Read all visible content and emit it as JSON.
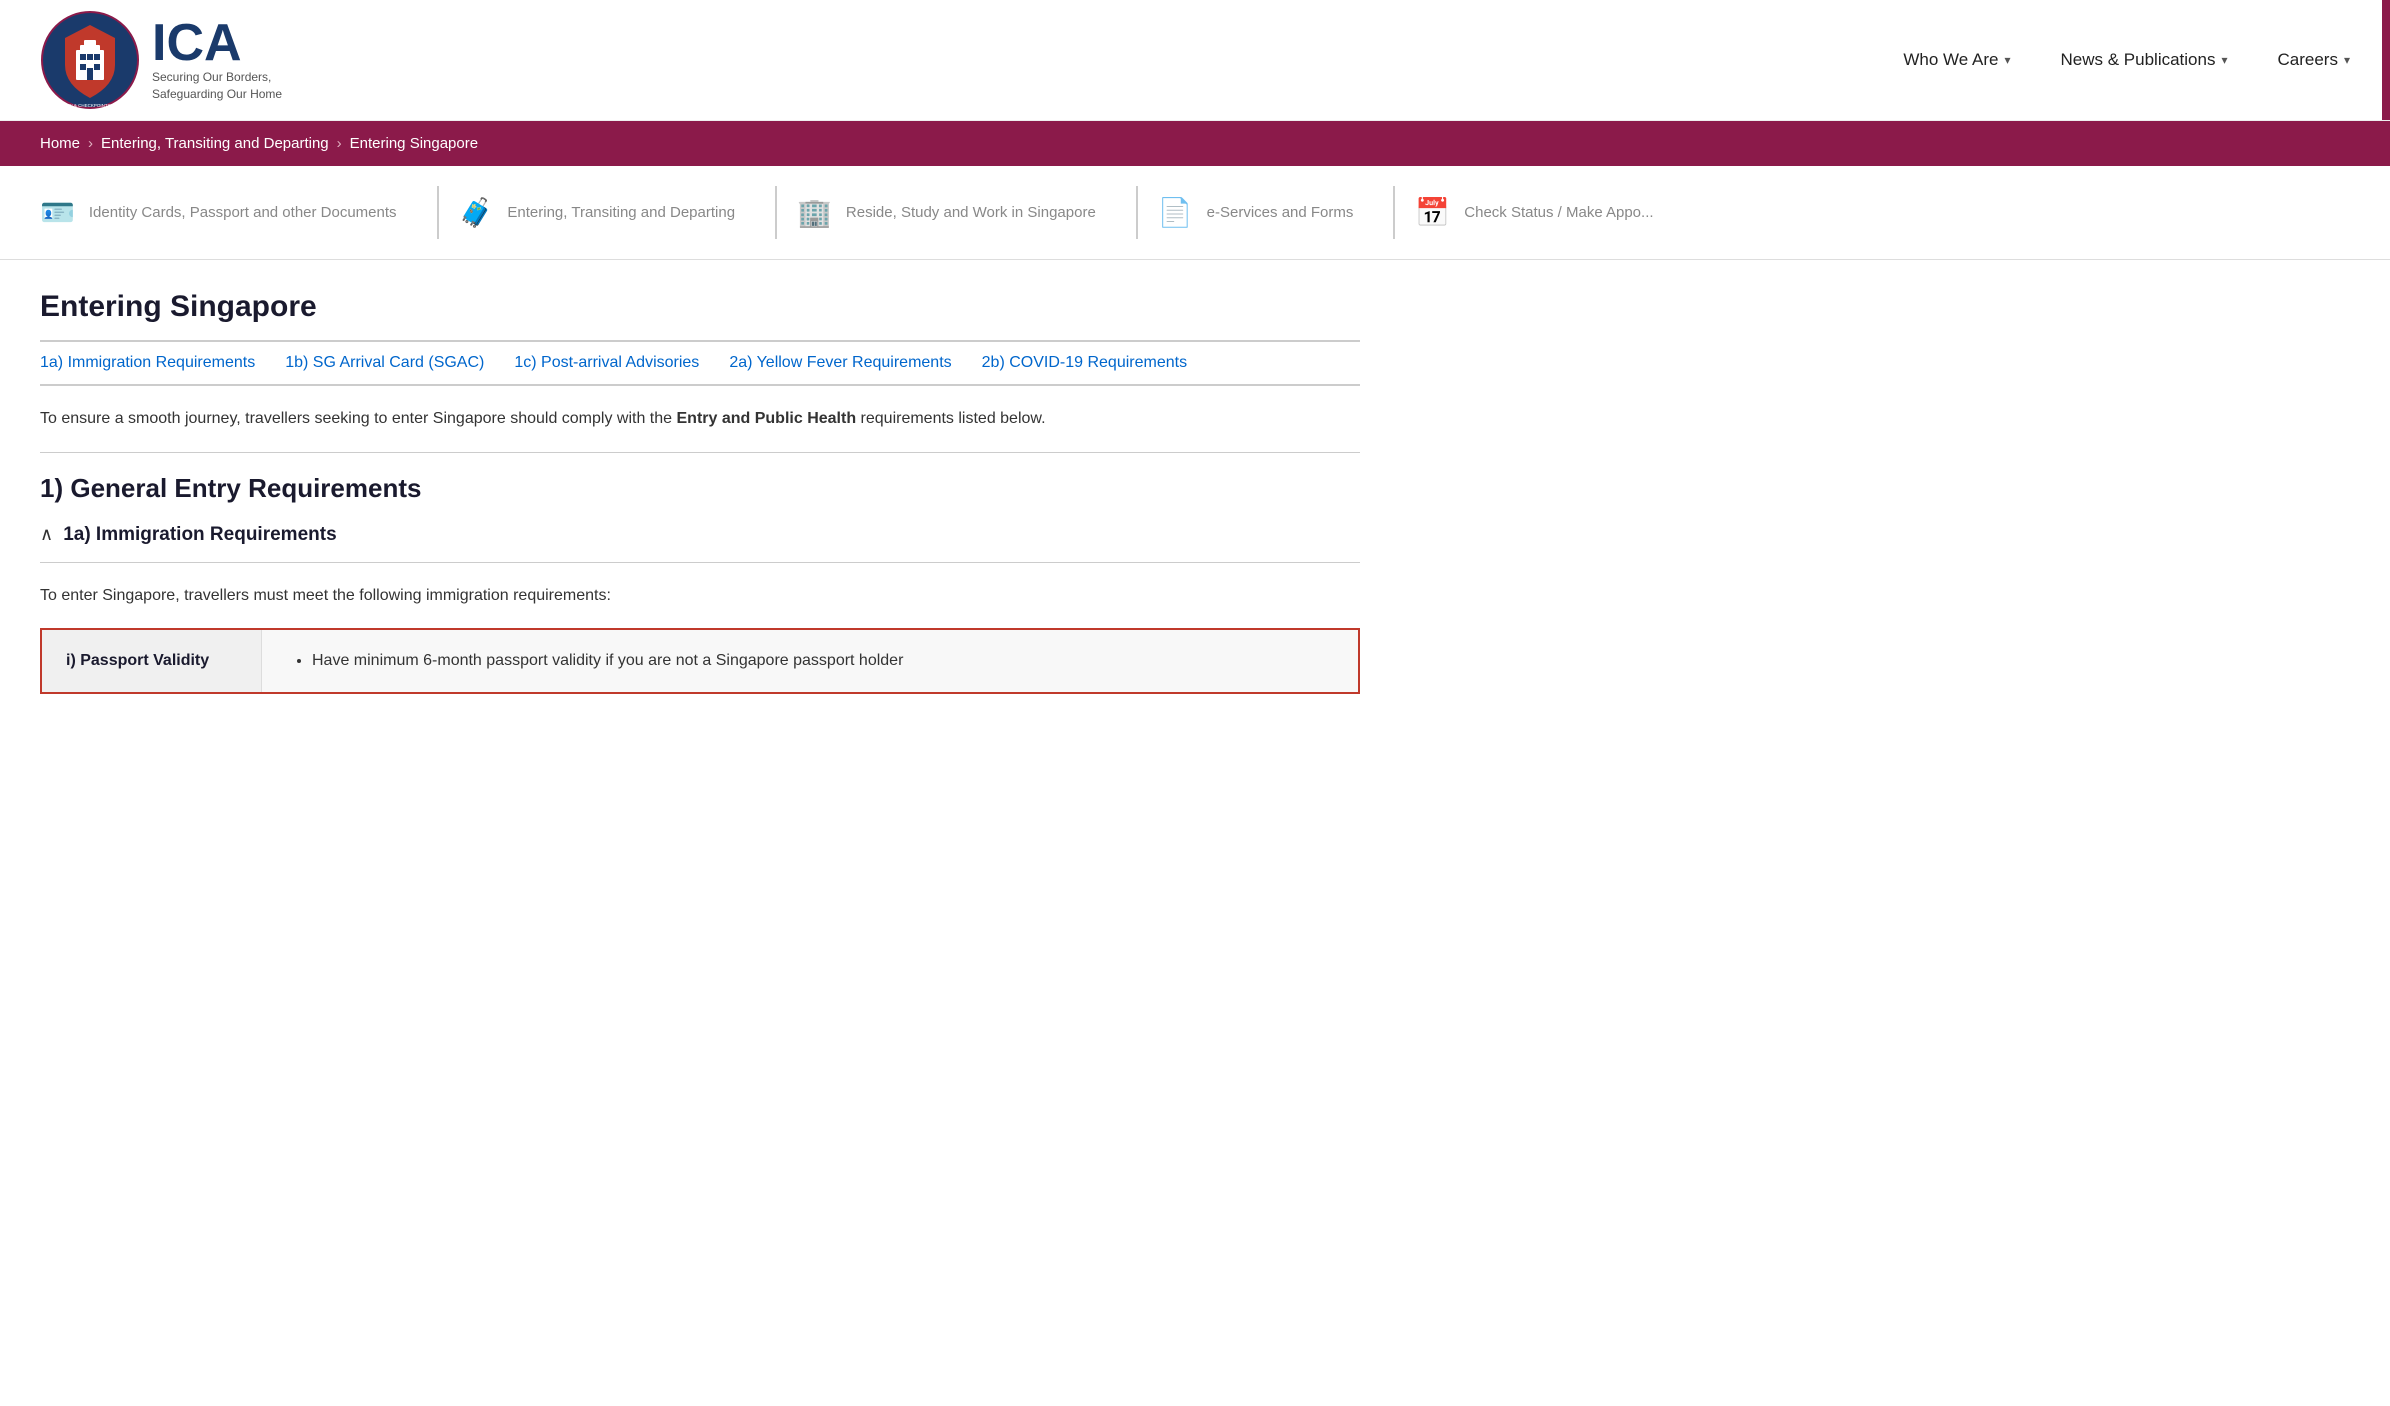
{
  "header": {
    "logo_ica": "ICA",
    "logo_tagline_line1": "Securing Our Borders,",
    "logo_tagline_line2": "Safeguarding Our Home",
    "nav": [
      {
        "id": "who-we-are",
        "label": "Who We Are",
        "has_dropdown": true
      },
      {
        "id": "news-publications",
        "label": "News & Publications",
        "has_dropdown": true
      },
      {
        "id": "careers",
        "label": "Careers",
        "has_dropdown": true
      }
    ]
  },
  "breadcrumb": {
    "items": [
      {
        "label": "Home",
        "link": true
      },
      {
        "label": "Entering, Transiting and Departing",
        "link": true
      },
      {
        "label": "Entering Singapore",
        "link": false
      }
    ]
  },
  "subnav": {
    "items": [
      {
        "id": "identity-cards",
        "icon": "🪪",
        "label": "Identity Cards, Passport and other Documents"
      },
      {
        "id": "entering-transiting",
        "icon": "🧳",
        "label": "Entering, Transiting and Departing"
      },
      {
        "id": "reside-study",
        "icon": "🏢",
        "label": "Reside, Study and Work in Singapore"
      },
      {
        "id": "eservices",
        "icon": "📄",
        "label": "e-Services and Forms"
      },
      {
        "id": "check-status",
        "icon": "📅",
        "label": "Check Status / Make Appo..."
      }
    ]
  },
  "main": {
    "page_title": "Entering Singapore",
    "tabs": [
      {
        "id": "tab-1a",
        "label": "1a) Immigration Requirements"
      },
      {
        "id": "tab-1b",
        "label": "1b) SG Arrival Card (SGAC)"
      },
      {
        "id": "tab-1c",
        "label": "1c) Post-arrival Advisories"
      },
      {
        "id": "tab-2a",
        "label": "2a) Yellow Fever Requirements"
      },
      {
        "id": "tab-2b",
        "label": "2b) COVID-19 Requirements"
      }
    ],
    "intro_text_before_bold": "To ensure a smooth journey, travellers seeking to enter Singapore should comply with the ",
    "intro_text_bold": "Entry and Public Health",
    "intro_text_after_bold": " requirements listed below.",
    "section_heading": "1) General Entry Requirements",
    "accordion_title": "1a) Immigration Requirements",
    "accordion_body": "To enter Singapore, travellers must meet the following immigration requirements:",
    "passport_row": {
      "label": "i) Passport Validity",
      "requirement": "Have minimum 6-month passport validity if you are not a Singapore passport holder"
    }
  }
}
